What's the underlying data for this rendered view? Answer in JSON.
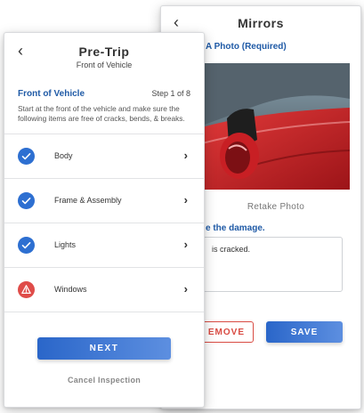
{
  "back_screen": {
    "back_icon": "chevron-left-icon",
    "title": "Mirrors",
    "photo_label": "A Photo (Required)",
    "retake_label": "Retake Photo",
    "describe_label": "e the damage.",
    "description_value": "is cracked.",
    "remove_label": "EMOVE",
    "save_label": "SAVE"
  },
  "front_screen": {
    "back_icon": "chevron-left-icon",
    "title": "Pre-Trip",
    "subtitle": "Front of Vehicle",
    "section_title": "Front of Vehicle",
    "step": "Step 1 of 8",
    "instructions": "Start at the front of the vehicle and make sure the following items are free of cracks, bends, & breaks.",
    "items": [
      {
        "label": "Body",
        "status": "check-icon"
      },
      {
        "label": "Frame & Assembly",
        "status": "check-icon"
      },
      {
        "label": "Lights",
        "status": "check-icon"
      },
      {
        "label": "Windows",
        "status": "warning-icon"
      }
    ],
    "next_label": "NEXT",
    "cancel_label": "Cancel Inspection"
  },
  "colors": {
    "accent_blue": "#2d6fd1",
    "link_blue": "#1f5aa6",
    "warning_red": "#df4c49"
  }
}
